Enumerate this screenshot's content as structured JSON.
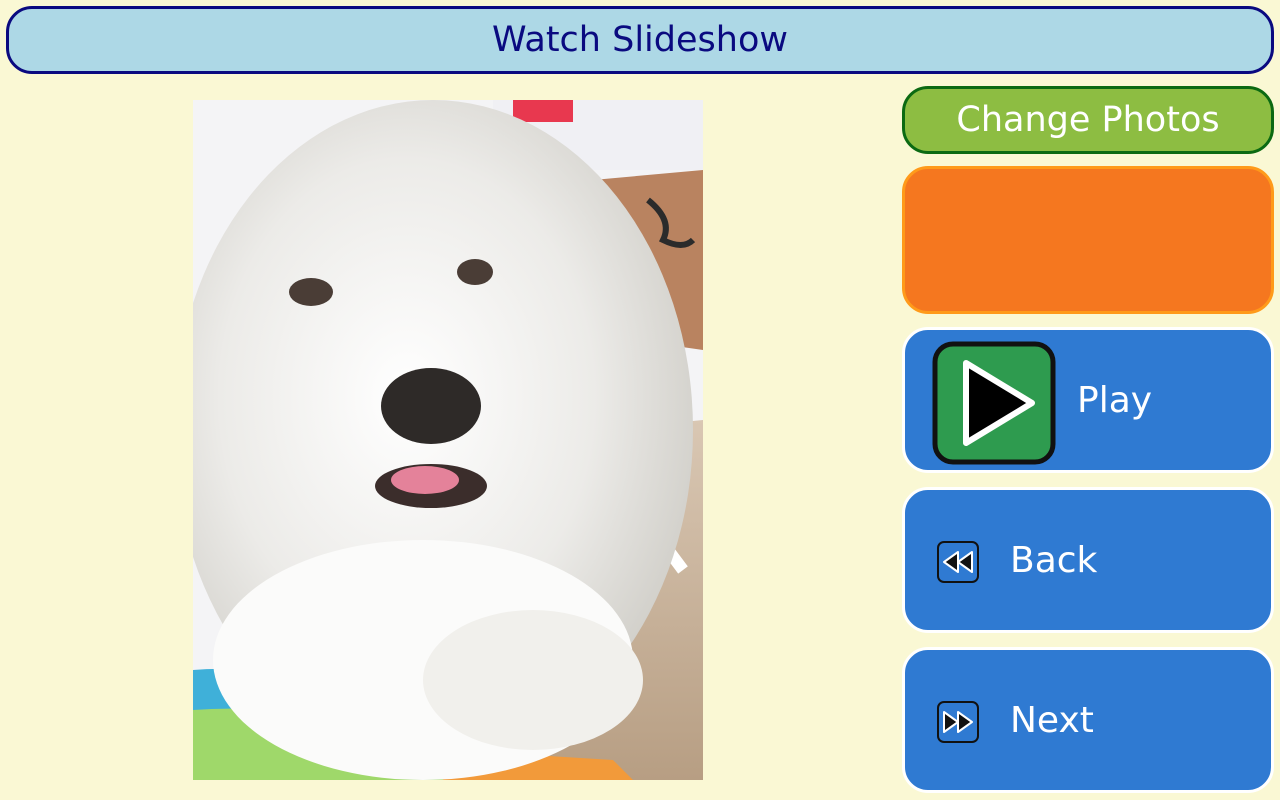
{
  "header": {
    "title": "Watch Slideshow"
  },
  "photo": {
    "alt": ""
  },
  "sidebar": {
    "change_photos_label": "Change Photos",
    "play": {
      "label": "Play",
      "icon": "play-icon"
    },
    "back": {
      "label": "Back",
      "icon": "rewind-icon"
    },
    "next": {
      "label": "Next",
      "icon": "fast-forward-icon"
    }
  },
  "colors": {
    "background": "#faf8d4",
    "title_bg": "#add8e6",
    "title_border": "#0a0a80",
    "change_bg": "#8dbd42",
    "change_border": "#0b6a12",
    "orange": "#f5771f",
    "blue_button": "#2f7ad2",
    "play_green": "#2e9b4f"
  }
}
